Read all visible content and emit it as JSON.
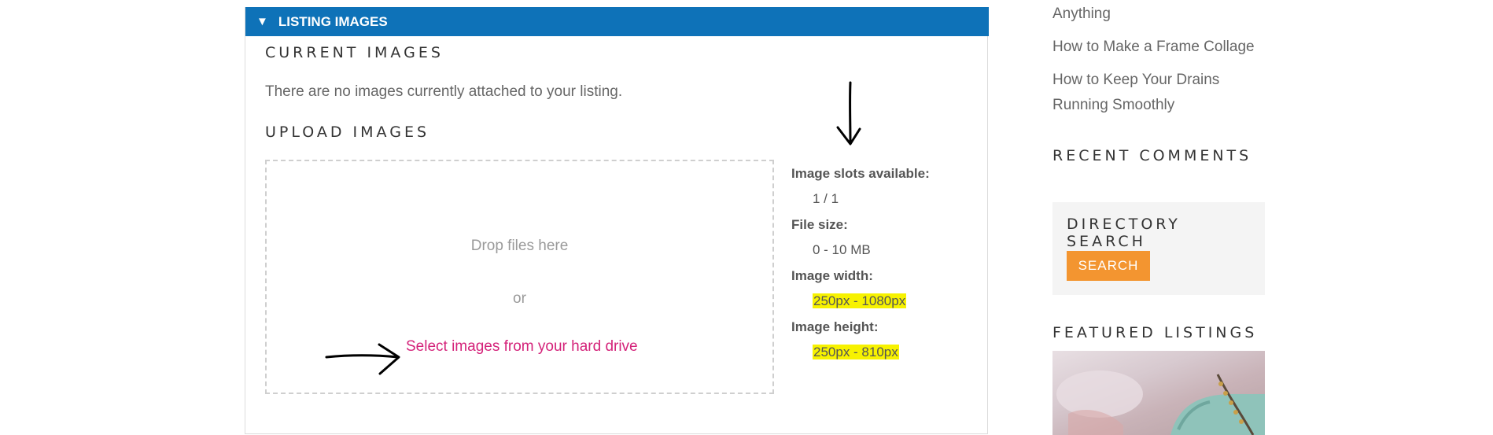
{
  "panel": {
    "header_icon": "triangle-down-icon",
    "header_glyph": "▼",
    "header_title": "LISTING IMAGES",
    "header_color": "#0e72b8"
  },
  "current_images": {
    "heading": "CURRENT IMAGES",
    "empty_message": "There are no images currently attached to your listing."
  },
  "upload": {
    "heading": "UPLOAD IMAGES",
    "drop_text": "Drop files here",
    "or_text": "or",
    "select_link": "Select images from your hard drive",
    "link_color": "#d4237a"
  },
  "image_info": {
    "slots_label": "Image slots available:",
    "slots_value": "1 / 1",
    "size_label": "File size:",
    "size_value": "0 - 10 MB",
    "width_label": "Image width:",
    "width_value": "250px - 1080px",
    "height_label": "Image height:",
    "height_value": "250px - 810px",
    "highlight_color": "#f7f200"
  },
  "annotations": [
    "down-arrow-icon",
    "right-arrow-icon"
  ],
  "sidebar": {
    "links": [
      "Anything",
      "How to Make a Frame Collage",
      "How to Keep Your Drains",
      "Running Smoothly"
    ],
    "recent_comments_heading": "RECENT COMMENTS",
    "directory_search_heading": "DIRECTORY SEARCH",
    "search_button": "SEARCH",
    "search_button_color": "#f39530",
    "featured_heading": "FEATURED LISTINGS"
  }
}
